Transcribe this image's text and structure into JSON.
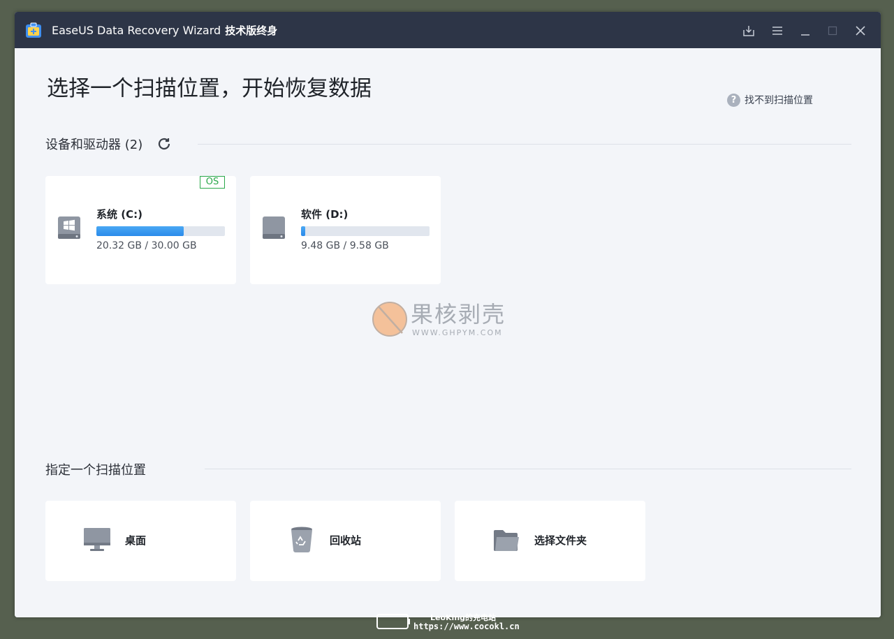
{
  "window": {
    "app_name": "EaseUS Data Recovery Wizard",
    "edition": "技术版终身",
    "icons": [
      "app-icon",
      "download-icon",
      "menu-icon",
      "minimize-icon",
      "maximize-icon",
      "close-icon"
    ]
  },
  "main": {
    "heading": "选择一个扫描位置，开始恢复数据",
    "help_link": "找不到扫描位置",
    "devices_section": {
      "title": "设备和驱动器 (2)",
      "drives": [
        {
          "name": "系统 (C:)",
          "size": "20.32 GB / 30.00 GB",
          "used_fraction": 0.677,
          "badge": "OS",
          "icon": "windows-drive-icon"
        },
        {
          "name": "软件 (D:)",
          "size": "9.48 GB / 9.58 GB",
          "used_fraction": 0.03,
          "icon": "hard-drive-icon"
        }
      ]
    },
    "location_section": {
      "title": "指定一个扫描位置",
      "locations": [
        {
          "label": "桌面",
          "icon": "desktop-icon"
        },
        {
          "label": "回收站",
          "icon": "recycle-bin-icon"
        },
        {
          "label": "选择文件夹",
          "icon": "folder-icon"
        }
      ]
    }
  },
  "watermark": {
    "text": "果核剥壳",
    "url": "WWW.GHPYM.COM",
    "footer_line1": "LeoKing的充电站",
    "footer_line2": "https://www.cocokl.cn"
  },
  "colors": {
    "titlebar": "#2d3547",
    "background": "#f3f5f9",
    "accent": "#2a8bea",
    "os_badge": "#2aa84a"
  }
}
